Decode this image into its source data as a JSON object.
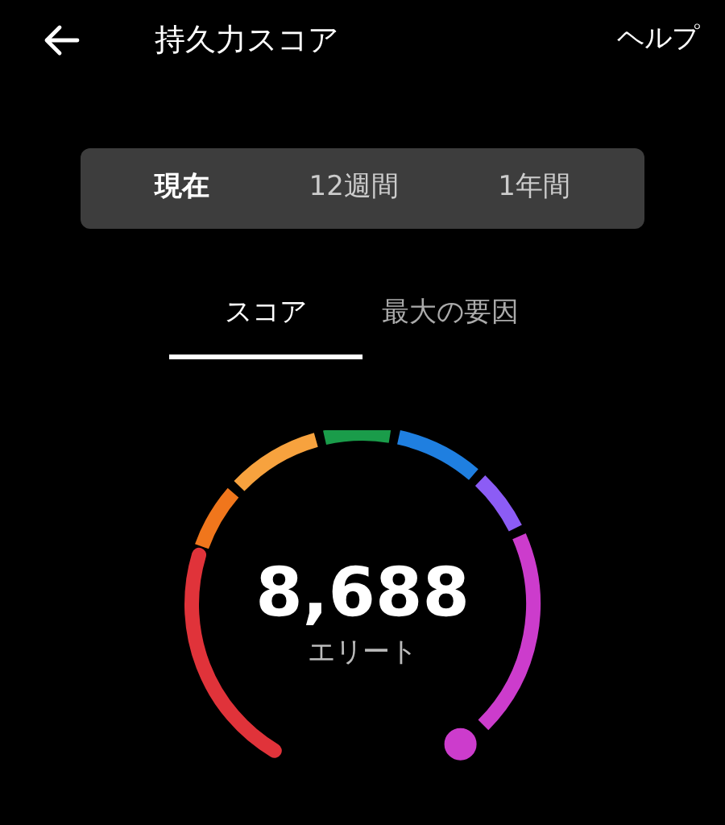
{
  "header": {
    "title": "持久力スコア",
    "help": "ヘルプ"
  },
  "periods": [
    {
      "label": "現在",
      "selected": true
    },
    {
      "label": "12週間",
      "selected": false
    },
    {
      "label": "1年間",
      "selected": false
    }
  ],
  "tabs": [
    {
      "label": "スコア",
      "selected": true
    },
    {
      "label": "最大の要因",
      "selected": false
    }
  ],
  "gauge": {
    "value": "8,688",
    "category": "エリート",
    "segments": [
      {
        "color": "#e0333a"
      },
      {
        "color": "#f0761c"
      },
      {
        "color": "#f7a23e"
      },
      {
        "color": "#1a9c4a"
      },
      {
        "color": "#1f7fe0"
      },
      {
        "color": "#8c5cf5"
      },
      {
        "color": "#cc3ccc"
      }
    ]
  }
}
